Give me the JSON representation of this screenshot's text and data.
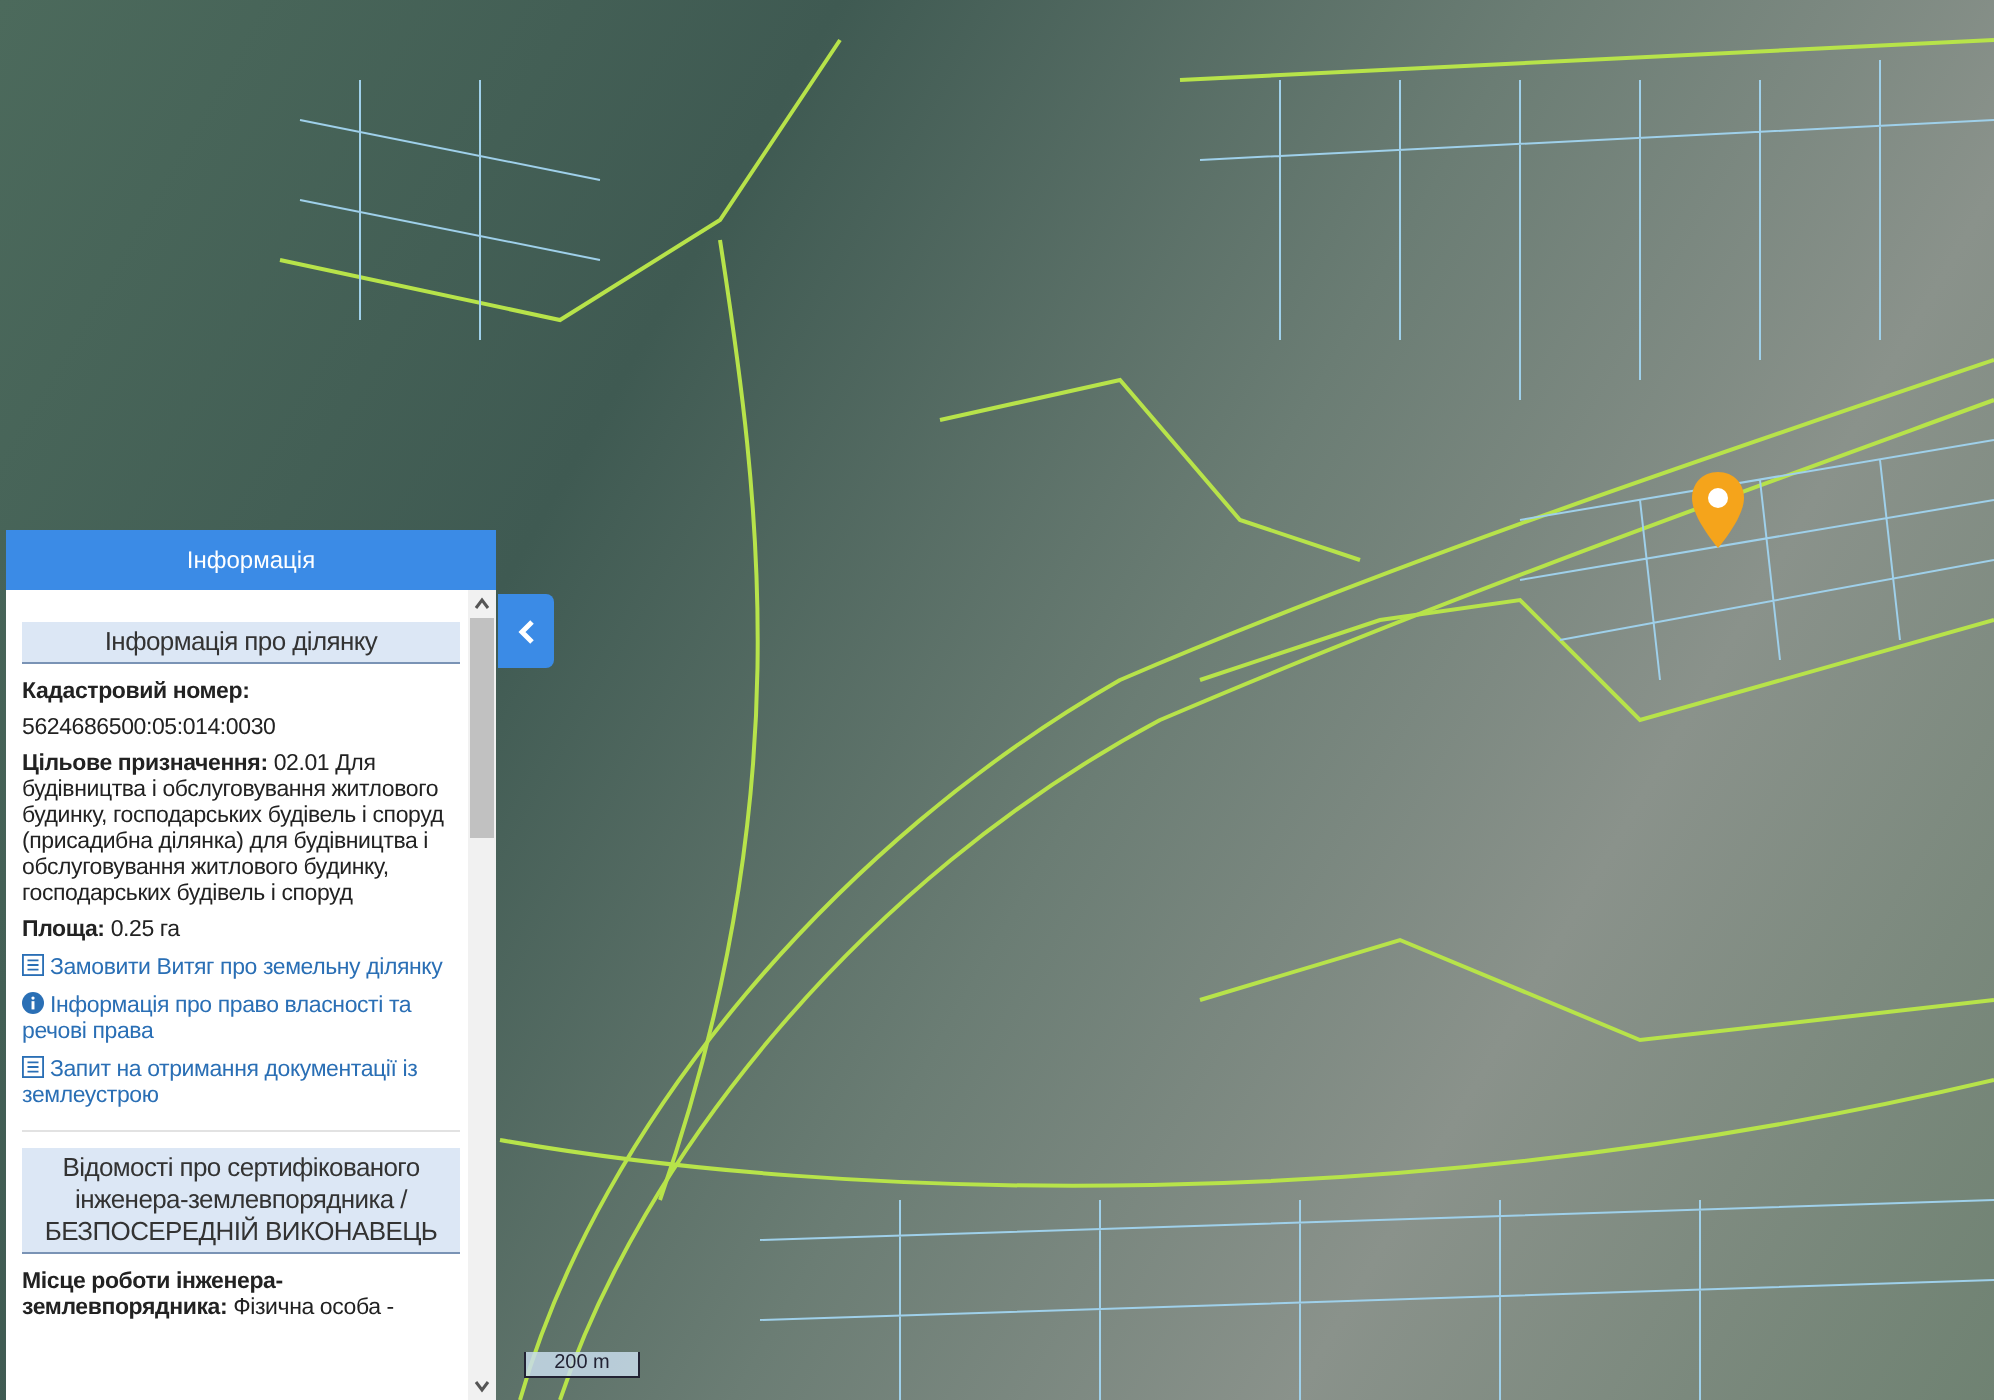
{
  "panel": {
    "title": "Інформація",
    "heading": "Інформація про ділянку",
    "fields": [
      {
        "kind": "block",
        "label": "Кадастровий номер:",
        "value": "5624686500:05:014:0030"
      },
      {
        "kind": "inline",
        "label": "Цільове призначення:",
        "value": "02.01 Для будівництва і обслуговування житлового будинку, господарських будівель і споруд (присадибна ділянка) для будівництва і обслуговування житлового будинку, господарських будівель і споруд"
      },
      {
        "kind": "inline",
        "label": "Площа:",
        "value": "0.25 га"
      }
    ],
    "links": [
      {
        "kind": "list",
        "text": "Замовити Витяг про земельну ділянку"
      },
      {
        "kind": "info",
        "text": "Інформація про право власності та речові права"
      },
      {
        "kind": "list",
        "text": "Запит на отримання документації із землеустрою"
      }
    ],
    "heading2": "Відомості про сертифікованого інженера-землевпорядника / БЕЗПОСЕРЕДНІЙ ВИКОНАВЕЦЬ",
    "fields2": [
      {
        "kind": "inline",
        "label": "Місце роботи інженера-землевпорядника:",
        "value": "Фізична особа -"
      }
    ]
  },
  "map": {
    "scale": "200 m"
  }
}
